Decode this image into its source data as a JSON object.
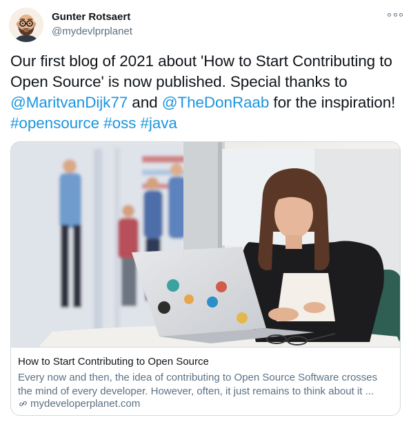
{
  "author": {
    "name": "Gunter Rotsaert",
    "handle": "@mydevlprplanet"
  },
  "tweet": {
    "line1": "Our first blog of 2021 about 'How to Start Contributing to",
    "line2": "Open Source' is now published. Special thanks to",
    "mention1": "@MaritvanDijk77",
    "and_text": " and ",
    "mention2": "@TheDonRaab",
    "inspiration_text": " for the inspiration!",
    "hashtags": [
      "#opensource",
      "#oss",
      "#java"
    ]
  },
  "card": {
    "title": "How to Start Contributing to Open Source",
    "description_line1": "Every now and then, the idea of contributing to Open Source Software crosses",
    "description_line2": "the mind of every developer. However, often, it just remains to think about it ...",
    "domain": "mydeveloperplanet.com"
  },
  "icons": {
    "more": "more-options-icon",
    "link": "link-icon"
  },
  "colors": {
    "link": "#1b95e0",
    "secondary_text": "#5b7083",
    "border": "#cfd9de"
  }
}
